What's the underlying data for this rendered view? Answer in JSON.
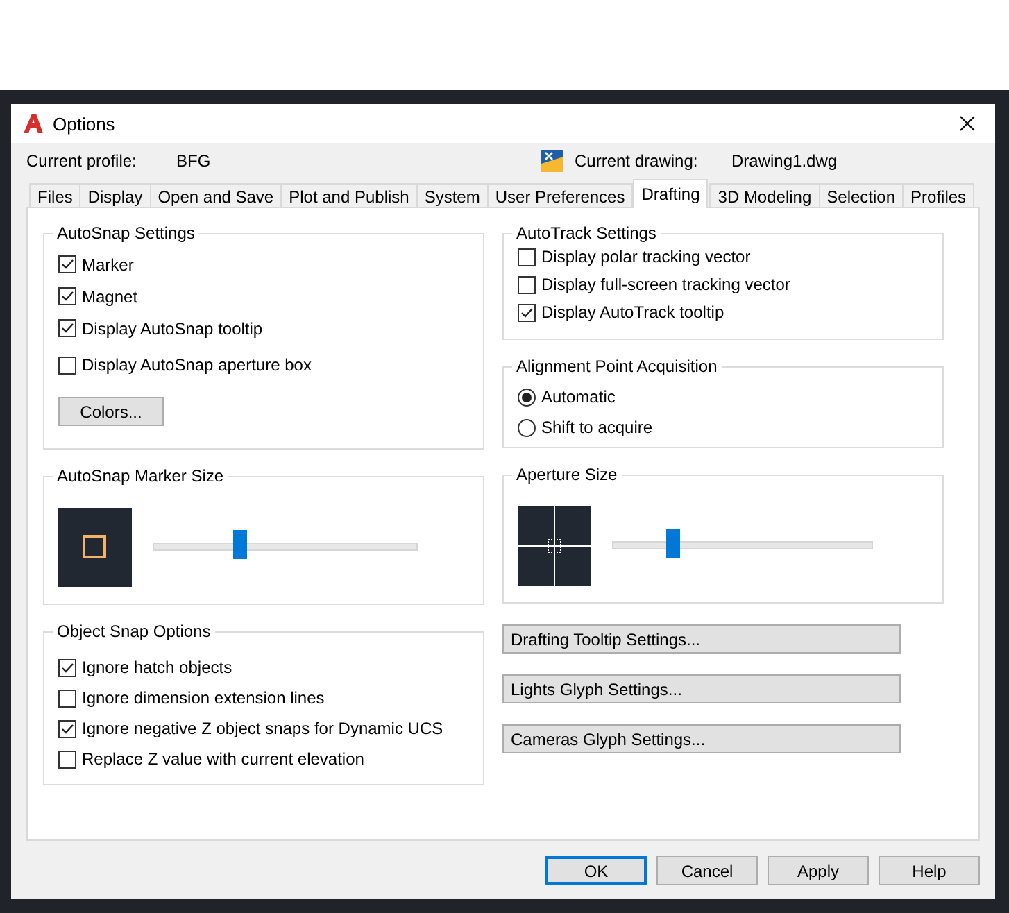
{
  "window": {
    "title": "Options"
  },
  "profile": {
    "label": "Current profile:",
    "value": "BFG"
  },
  "drawing": {
    "label": "Current drawing:",
    "value": "Drawing1.dwg"
  },
  "tabs": [
    {
      "label": "Files",
      "selected": false
    },
    {
      "label": "Display",
      "selected": false
    },
    {
      "label": "Open and Save",
      "selected": false
    },
    {
      "label": "Plot and Publish",
      "selected": false
    },
    {
      "label": "System",
      "selected": false
    },
    {
      "label": "User Preferences",
      "selected": false
    },
    {
      "label": "Drafting",
      "selected": true
    },
    {
      "label": "3D Modeling",
      "selected": false
    },
    {
      "label": "Selection",
      "selected": false
    },
    {
      "label": "Profiles",
      "selected": false
    }
  ],
  "autosnap_settings": {
    "title": "AutoSnap Settings",
    "options": [
      {
        "label": "Marker",
        "checked": true
      },
      {
        "label": "Magnet",
        "checked": true
      },
      {
        "label": "Display AutoSnap tooltip",
        "checked": true
      },
      {
        "label": "Display AutoSnap aperture box",
        "checked": false
      }
    ],
    "button": "Colors..."
  },
  "autosnap_marker_size": {
    "title": "AutoSnap Marker Size",
    "level": 0.33
  },
  "object_snap_options": {
    "title": "Object Snap Options",
    "options": [
      {
        "label": "Ignore hatch objects",
        "checked": true
      },
      {
        "label": "Ignore dimension extension lines",
        "checked": false
      },
      {
        "label": "Ignore negative Z object snaps for Dynamic UCS",
        "checked": true
      },
      {
        "label": "Replace Z value with current elevation",
        "checked": false
      }
    ]
  },
  "autotrack_settings": {
    "title": "AutoTrack Settings",
    "options": [
      {
        "label": "Display polar tracking vector",
        "checked": false
      },
      {
        "label": "Display full-screen tracking vector",
        "checked": false
      },
      {
        "label": "Display AutoTrack tooltip",
        "checked": true
      }
    ]
  },
  "alignment_point_acquisition": {
    "title": "Alignment Point Acquisition",
    "options": [
      {
        "label": "Automatic",
        "selected": true
      },
      {
        "label": "Shift to acquire",
        "selected": false
      }
    ]
  },
  "aperture_size": {
    "title": "Aperture Size",
    "level": 0.23
  },
  "side_buttons": [
    "Drafting Tooltip Settings...",
    "Lights Glyph Settings...",
    "Cameras Glyph Settings..."
  ],
  "buttons": [
    {
      "label": "OK",
      "default": true
    },
    {
      "label": "Cancel",
      "default": false
    },
    {
      "label": "Apply",
      "default": false
    },
    {
      "label": "Help",
      "default": false
    }
  ]
}
